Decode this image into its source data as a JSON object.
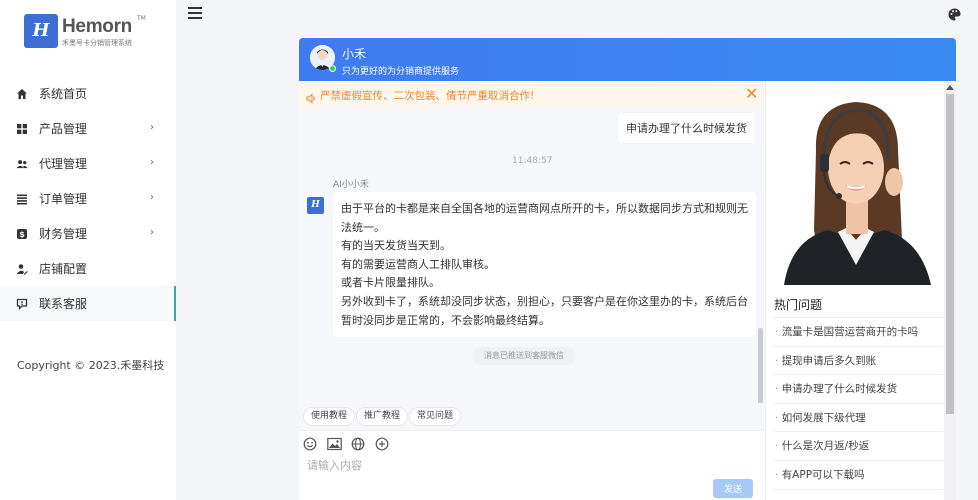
{
  "brand": {
    "name": "Hemorn",
    "tm": "TM",
    "tagline": "禾墨号卡分销管理系统"
  },
  "sidebar": {
    "items": [
      {
        "label": "系统首页",
        "icon": "home-icon",
        "arrow": false
      },
      {
        "label": "产品管理",
        "icon": "grid-icon",
        "arrow": true
      },
      {
        "label": "代理管理",
        "icon": "users-icon",
        "arrow": true
      },
      {
        "label": "订单管理",
        "icon": "list-icon",
        "arrow": true
      },
      {
        "label": "财务管理",
        "icon": "dollar-icon",
        "arrow": true
      },
      {
        "label": "店铺配置",
        "icon": "user-edit-icon",
        "arrow": false
      },
      {
        "label": "联系客服",
        "icon": "chat-icon",
        "arrow": false,
        "active": true
      }
    ],
    "copyright": "Copyright © 2023.禾墨科技"
  },
  "chat": {
    "agent_name": "小禾",
    "agent_desc": "只为更好的为分销商提供服务",
    "notice": "严禁虚假宣传、二次包装、倩节严重取消合作!",
    "user_message": "申请办理了什么时候发货",
    "time": "11:48:57",
    "bot_name": "AI小小禾",
    "bot_lines": [
      "由于平台的卡都是来自全国各地的运营商网点所开的卡，所以数据同步方式和规则无法统一。",
      "有的当天发货当天到。",
      "有的需要运营商人工排队审核。",
      "或者卡片限量排队。",
      "另外收到卡了，系统却没同步状态，别担心，只要客户是在你这里办的卡，系统后台暂时没同步是正常的，不会影响最终结算。"
    ],
    "system_note": "消息已推送到客服微信",
    "quick_buttons": [
      "使用教程",
      "推广教程",
      "常见问题"
    ],
    "input_placeholder": "请输入内容",
    "send_label": "发送"
  },
  "hot": {
    "title": "热门问题",
    "items": [
      "流量卡是国营运营商开的卡吗",
      "提现申请后多久到账",
      "申请办理了什么时候发货",
      "如何发展下级代理",
      "什么是次月返/秒返",
      "有APP可以下载吗"
    ]
  },
  "colors": {
    "header_blue": "#3e7bf0",
    "notice_orange": "#e6882e",
    "send_button": "#a6c9f7",
    "active_indicator": "#3aa9a6"
  }
}
